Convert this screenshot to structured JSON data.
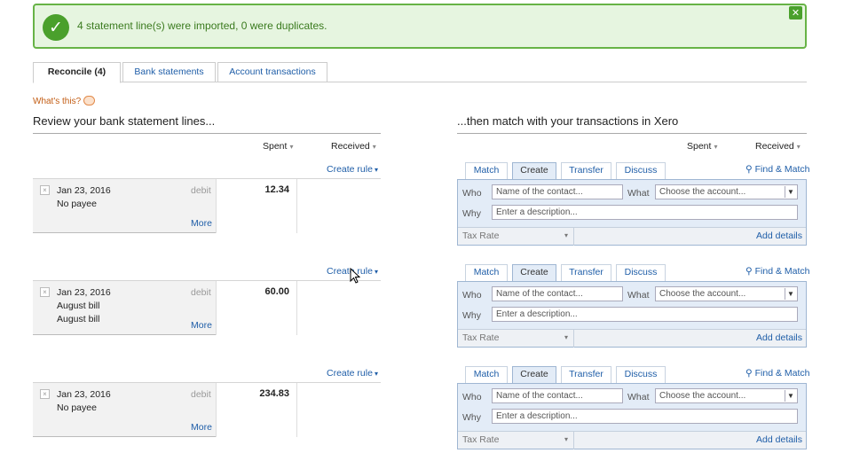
{
  "banner": {
    "message": "4 statement line(s) were imported, 0 were duplicates.",
    "check_icon": "✓",
    "close_icon": "✕",
    "color": "#4aa02c"
  },
  "tabs": [
    {
      "label": "Reconcile (4)",
      "active": true
    },
    {
      "label": "Bank statements",
      "active": false
    },
    {
      "label": "Account transactions",
      "active": false
    }
  ],
  "whats_this": "What's this?",
  "left": {
    "title": "Review your bank statement lines...",
    "spent_label": "Spent",
    "received_label": "Received",
    "caret": "▾",
    "create_rule": "Create rule",
    "create_rule_caret": "▾"
  },
  "right": {
    "title": "...then match with your transactions in Xero",
    "spent_label": "Spent",
    "received_label": "Received",
    "caret": "▾"
  },
  "match_tabs": [
    "Match",
    "Create",
    "Transfer",
    "Discuss"
  ],
  "find_match": "Find & Match",
  "form": {
    "who_label": "Who",
    "what_label": "What",
    "why_label": "Why",
    "contact_placeholder": "Name of the contact...",
    "account_placeholder": "Choose the account...",
    "description_placeholder": "Enter a description...",
    "tax_rate": "Tax Rate",
    "add_details": "Add details",
    "dropdown_caret": "▼",
    "small_caret": "▾"
  },
  "lines": [
    {
      "date": "Jan 23, 2016",
      "payee": "No payee",
      "payee2": "",
      "type": "debit",
      "spent": "12.34",
      "received": "",
      "more": "More",
      "remove": "×"
    },
    {
      "date": "Jan 23, 2016",
      "payee": "August bill",
      "payee2": "August bill",
      "type": "debit",
      "spent": "60.00",
      "received": "",
      "more": "More",
      "remove": "×"
    },
    {
      "date": "Jan 23, 2016",
      "payee": "No payee",
      "payee2": "",
      "type": "debit",
      "spent": "234.83",
      "received": "",
      "more": "More",
      "remove": "×"
    }
  ]
}
